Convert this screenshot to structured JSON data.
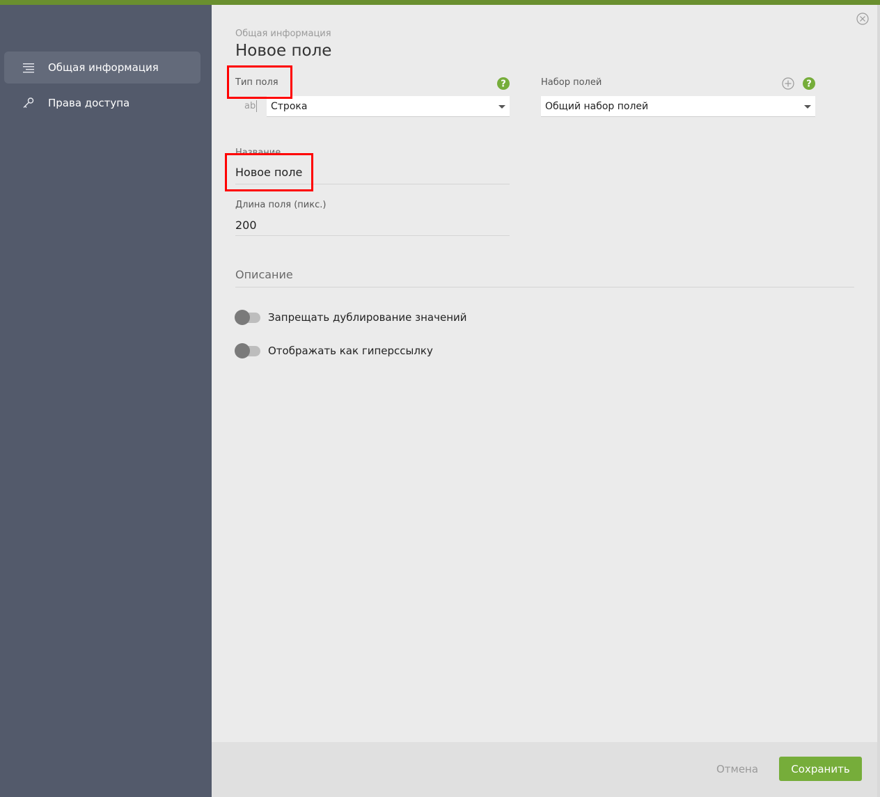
{
  "sidebar": {
    "items": [
      {
        "label": "Общая информация",
        "icon": "list-icon",
        "active": true
      },
      {
        "label": "Права доступа",
        "icon": "key-icon",
        "active": false
      }
    ]
  },
  "header": {
    "breadcrumb": "Общая информация",
    "title": "Новое поле"
  },
  "field_type": {
    "label": "Тип поля",
    "prefix": "ab",
    "value": "Строка"
  },
  "field_set": {
    "label": "Набор полей",
    "value": "Общий набор полей"
  },
  "name": {
    "label": "Название",
    "value": "Новое поле"
  },
  "length": {
    "label": "Длина поля (пикс.)",
    "value": "200"
  },
  "description": {
    "title": "Описание"
  },
  "toggles": [
    {
      "label": "Запрещать дублирование значений",
      "on": false
    },
    {
      "label": "Отображать как гиперссылку",
      "on": false
    }
  ],
  "footer": {
    "cancel_label": "Отмена",
    "save_label": "Сохранить"
  },
  "colors": {
    "accent": "#76ad3a",
    "sidebar": "#535a6b",
    "highlight": "#ff0000"
  }
}
